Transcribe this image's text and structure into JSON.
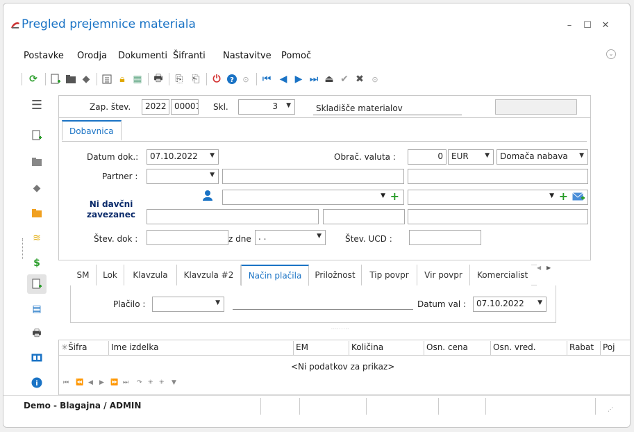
{
  "window": {
    "title": "Pregled prejemnice materiala"
  },
  "menu": [
    "Postavke",
    "Orodja",
    "Dokumenti",
    "Šifranti",
    "Nastavitve",
    "Pomoč"
  ],
  "header": {
    "zap_label": "Zap. štev.",
    "zap_year": "2022",
    "zap_num": "00001",
    "skl_label": "Skl.",
    "skl_value": "3",
    "skl_name": "Skladišče materialov"
  },
  "tab_main": "Dobavnica",
  "form": {
    "datum_label": "Datum dok.:",
    "datum_value": "07.10.2022",
    "valuta_label": "Obrač. valuta :",
    "valuta_rate": "0",
    "valuta_code": "EUR",
    "nabava_value": "Domača nabava",
    "partner_label": "Partner :",
    "tax_status": "Ni davčni zavezanec",
    "stev_dok_label": "Štev. dok :",
    "z_dne_label": "z dne",
    "z_dne_value": ". .",
    "stev_ucd_label": "Štev. UCD :"
  },
  "subtabs": [
    "SM",
    "Lok",
    "Klavzula",
    "Klavzula #2",
    "Način plačila",
    "Priložnost",
    "Tip povpr",
    "Vir povpr",
    "Komercialist"
  ],
  "payment": {
    "placilo_label": "Plačilo :",
    "datum_val_label": "Datum val :",
    "datum_val_value": "07.10.2022"
  },
  "grid": {
    "columns": [
      "Šifra",
      "Ime izdelka",
      "EM",
      "Količina",
      "Osn. cena",
      "Osn. vred.",
      "Rabat",
      "Poj"
    ],
    "empty": "<Ni podatkov za prikaz>"
  },
  "status": {
    "text": "Demo - Blagajna / ADMIN"
  },
  "colors": {
    "accent": "#1a73c5",
    "green": "#2a9d2a",
    "red": "#d32f2f"
  }
}
